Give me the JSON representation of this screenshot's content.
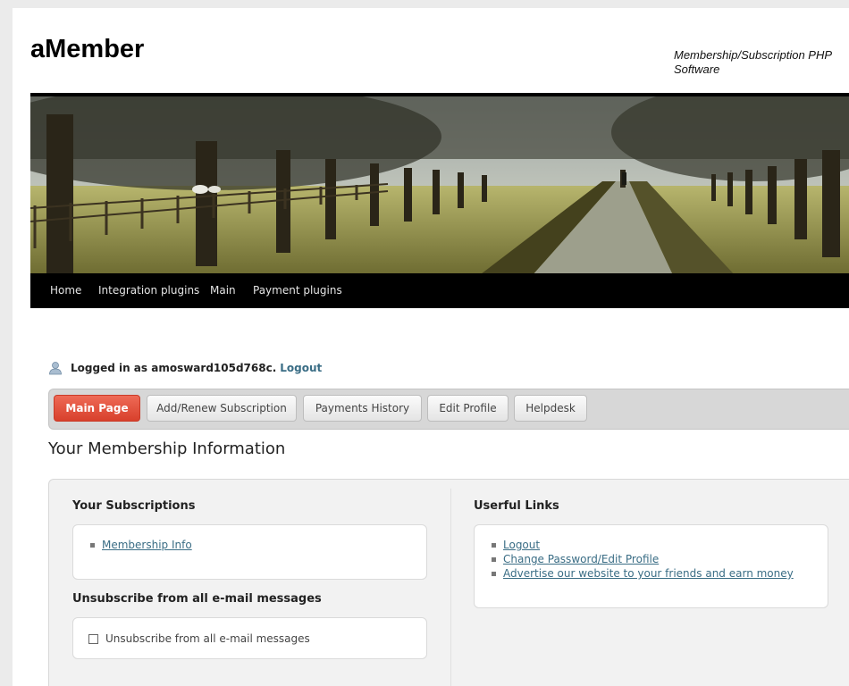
{
  "header": {
    "site_title": "aMember",
    "tagline": "Membership/Subscription PHP Software"
  },
  "topnav": {
    "items": [
      "Home",
      "Integration plugins",
      "Main",
      "Payment plugins"
    ]
  },
  "login": {
    "text": "Logged in as amosward105d768c.",
    "logout_label": "Logout"
  },
  "tabs": [
    {
      "label": "Main Page",
      "active": true
    },
    {
      "label": "Add/Renew Subscription",
      "active": false
    },
    {
      "label": "Payments History",
      "active": false
    },
    {
      "label": "Edit Profile",
      "active": false
    },
    {
      "label": "Helpdesk",
      "active": false
    }
  ],
  "main": {
    "heading": "Your Membership Information",
    "subscriptions": {
      "title": "Your Subscriptions",
      "items": [
        "Membership Info"
      ]
    },
    "unsubscribe": {
      "title": "Unsubscribe from all e-mail messages",
      "checkbox_label": "Unsubscribe from all e-mail messages",
      "checked": false
    },
    "useful_links": {
      "title": "Userful Links",
      "items": [
        "Logout",
        "Change Password/Edit Profile",
        "Advertise our website to your friends and earn money"
      ]
    }
  },
  "colors": {
    "active_tab": "#e05340",
    "link": "#3a6d85",
    "nav_bg": "#000000"
  }
}
